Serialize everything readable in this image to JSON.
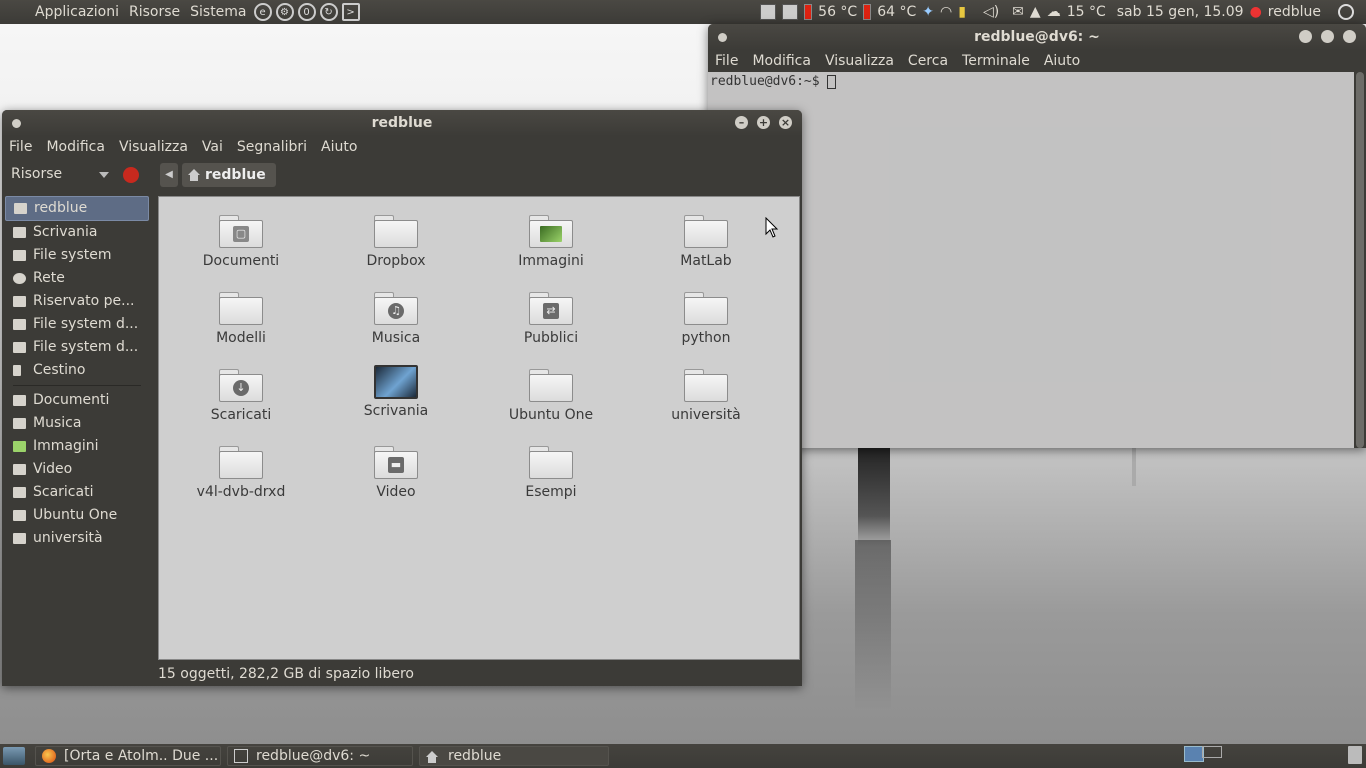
{
  "top_panel": {
    "menus": [
      "Applicazioni",
      "Risorse",
      "Sistema"
    ],
    "temp1": "56 °C",
    "temp2": "64 °C",
    "weather": "15 °C",
    "clock": "sab 15 gen, 15.09",
    "user": "redblue"
  },
  "terminal": {
    "title": "redblue@dv6: ~",
    "menu": [
      "File",
      "Modifica",
      "Visualizza",
      "Cerca",
      "Terminale",
      "Aiuto"
    ],
    "prompt": "redblue@dv6:~$ "
  },
  "file_manager": {
    "title": "redblue",
    "menu": [
      "File",
      "Modifica",
      "Visualizza",
      "Vai",
      "Segnalibri",
      "Aiuto"
    ],
    "places_label": "Risorse",
    "breadcrumb": "redblue",
    "sidebar": [
      {
        "label": "redblue",
        "icon": "home-icon"
      },
      {
        "label": "Scrivania",
        "icon": "desktop-icon"
      },
      {
        "label": "File system",
        "icon": "drive-icon"
      },
      {
        "label": "Rete",
        "icon": "network-icon"
      },
      {
        "label": "Riservato pe...",
        "icon": "drive-icon"
      },
      {
        "label": "File system d...",
        "icon": "drive-icon"
      },
      {
        "label": "File system d...",
        "icon": "drive-icon"
      },
      {
        "label": "Cestino",
        "icon": "trash-icon"
      }
    ],
    "bookmarks": [
      {
        "label": "Documenti",
        "icon": "folder-icon"
      },
      {
        "label": "Musica",
        "icon": "folder-icon"
      },
      {
        "label": "Immagini",
        "icon": "folder-icon"
      },
      {
        "label": "Video",
        "icon": "folder-icon"
      },
      {
        "label": "Scaricati",
        "icon": "folder-icon"
      },
      {
        "label": "Ubuntu One",
        "icon": "folder-icon"
      },
      {
        "label": "università",
        "icon": "folder-icon"
      }
    ],
    "items": [
      {
        "label": "Documenti",
        "icon": "documents-folder-icon"
      },
      {
        "label": "Dropbox",
        "icon": "folder-icon"
      },
      {
        "label": "Immagini",
        "icon": "pictures-folder-icon"
      },
      {
        "label": "MatLab",
        "icon": "folder-icon"
      },
      {
        "label": "Modelli",
        "icon": "folder-icon"
      },
      {
        "label": "Musica",
        "icon": "music-folder-icon"
      },
      {
        "label": "Pubblici",
        "icon": "public-folder-icon"
      },
      {
        "label": "python",
        "icon": "folder-icon"
      },
      {
        "label": "Scaricati",
        "icon": "download-folder-icon"
      },
      {
        "label": "Scrivania",
        "icon": "desktop-icon"
      },
      {
        "label": "Ubuntu One",
        "icon": "folder-icon"
      },
      {
        "label": "università",
        "icon": "folder-icon"
      },
      {
        "label": "v4l-dvb-drxd",
        "icon": "folder-icon"
      },
      {
        "label": "Video",
        "icon": "videos-folder-icon"
      },
      {
        "label": "Esempi",
        "icon": "folder-icon"
      }
    ],
    "status": "15 oggetti, 282,2 GB di spazio libero"
  },
  "bottom_panel": {
    "tasks": [
      {
        "label": "[Orta e Atolm.. Due ...",
        "icon": "firefox-icon"
      },
      {
        "label": "redblue@dv6: ~",
        "icon": "terminal-icon"
      },
      {
        "label": "redblue",
        "icon": "home-icon"
      }
    ]
  }
}
